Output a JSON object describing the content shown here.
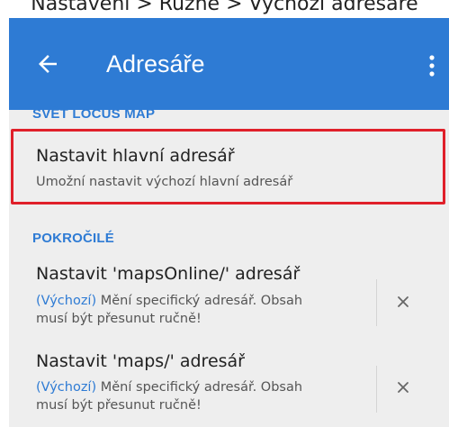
{
  "caption": "Nastavení > Různé > Výchozí adresáře",
  "appbar": {
    "title": "Adresáře",
    "back_icon": "arrow-left-icon",
    "menu_icon": "more-vert-icon"
  },
  "sections": {
    "locus": "SVĚT LOCUS MAP",
    "advanced": "POKROČILÉ"
  },
  "items": [
    {
      "title": "Nastavit hlavní adresář",
      "subtitle": "Umožní nastavit výchozí hlavní adresář"
    },
    {
      "title": "Nastavit 'mapsOnline/' adresář",
      "default_tag": "Výchozí",
      "paren_open": "(",
      "paren_close": ")",
      "line1": " Mění specifický adresář. Obsah",
      "line2": "musí být přesunut ručně!"
    },
    {
      "title": "Nastavit 'maps/' adresář",
      "default_tag": "Výchozí",
      "paren_open": "(",
      "paren_close": ")",
      "line1": " Mění specifický adresář. Obsah",
      "line2": "musí být přesunut ručně!"
    }
  ],
  "colors": {
    "appbar": "#2e7bd4",
    "accent": "#2e7bd4",
    "highlight": "#e0202a"
  }
}
